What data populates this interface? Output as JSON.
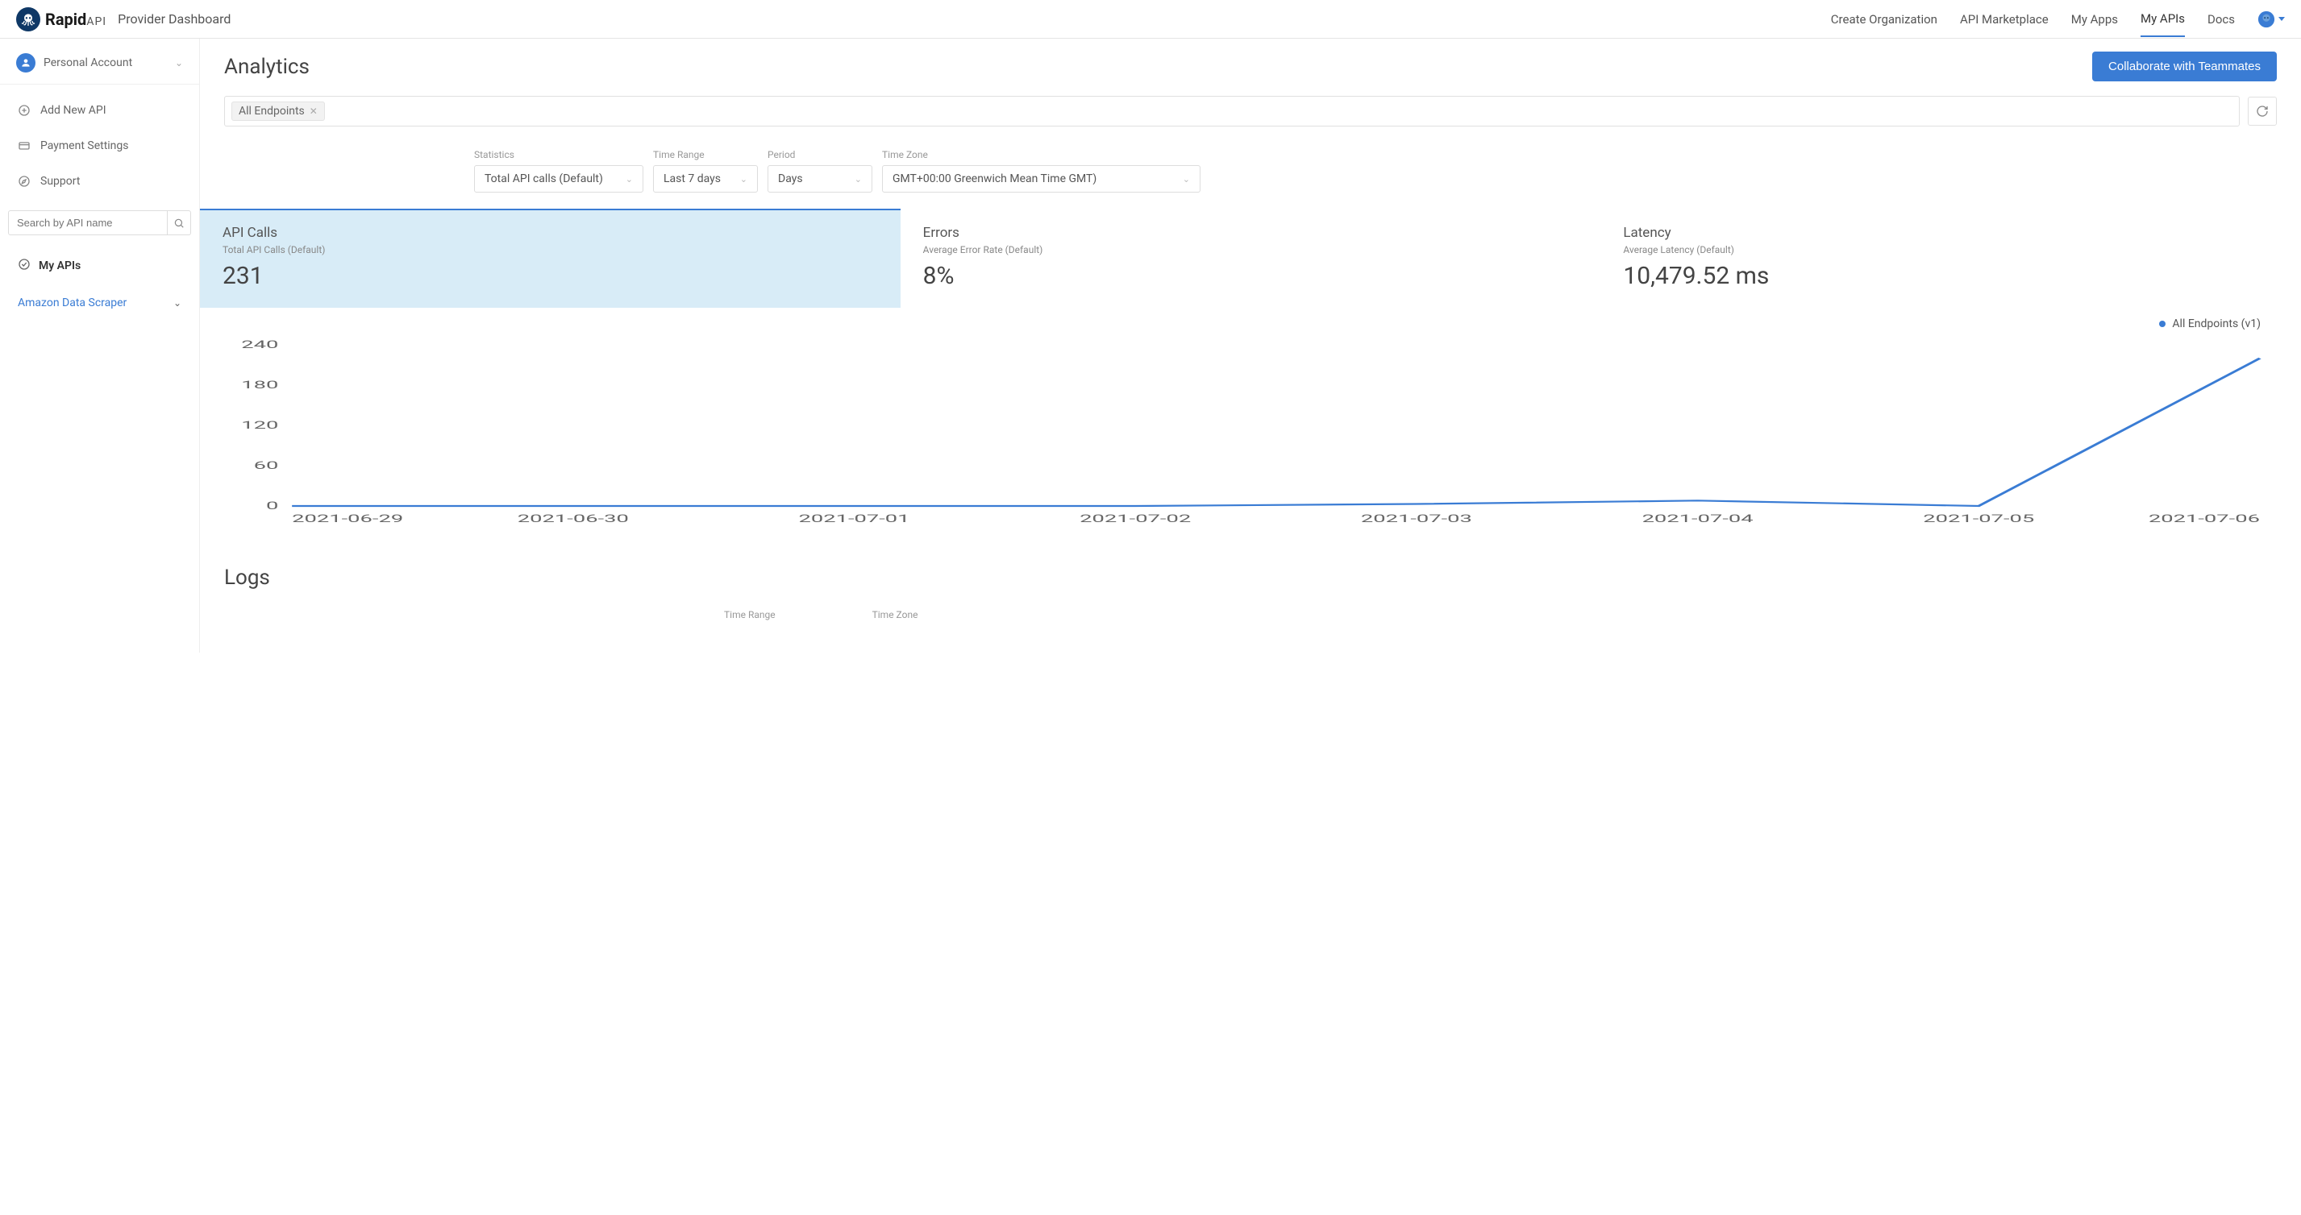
{
  "header": {
    "brand_main": "Rapid",
    "brand_sub": "API",
    "title": "Provider Dashboard",
    "nav": [
      "Create Organization",
      "API Marketplace",
      "My Apps",
      "My APIs",
      "Docs"
    ]
  },
  "sidebar": {
    "account_label": "Personal Account",
    "items": [
      {
        "label": "Add New API"
      },
      {
        "label": "Payment Settings"
      },
      {
        "label": "Support"
      }
    ],
    "search_placeholder": "Search by API name",
    "my_apis_label": "My APIs",
    "api_list": [
      {
        "label": "Amazon Data Scraper"
      }
    ]
  },
  "page": {
    "title": "Analytics",
    "collab_btn": "Collaborate with Teammates",
    "filter_chip": "All Endpoints",
    "controls": {
      "statistics_label": "Statistics",
      "statistics_value": "Total API calls (Default)",
      "timerange_label": "Time Range",
      "timerange_value": "Last 7 days",
      "period_label": "Period",
      "period_value": "Days",
      "timezone_label": "Time Zone",
      "timezone_value": "GMT+00:00 Greenwich Mean Time GMT)"
    },
    "cards": {
      "api_calls": {
        "title": "API Calls",
        "sub": "Total API Calls (Default)",
        "value": "231"
      },
      "errors": {
        "title": "Errors",
        "sub": "Average Error Rate (Default)",
        "value": "8%"
      },
      "latency": {
        "title": "Latency",
        "sub": "Average Latency (Default)",
        "value": "10,479.52 ms"
      }
    },
    "legend": "All Endpoints (v1)",
    "logs_title": "Logs",
    "logs_controls": {
      "timerange_label": "Time Range",
      "timezone_label": "Time Zone"
    }
  },
  "chart_data": {
    "type": "line",
    "title": "",
    "xlabel": "",
    "ylabel": "",
    "ylim": [
      0,
      240
    ],
    "y_ticks": [
      0,
      60,
      120,
      180,
      240
    ],
    "categories": [
      "2021-06-29",
      "2021-06-30",
      "2021-07-01",
      "2021-07-02",
      "2021-07-03",
      "2021-07-04",
      "2021-07-05",
      "2021-07-06"
    ],
    "series": [
      {
        "name": "All Endpoints (v1)",
        "values": [
          0,
          0,
          0,
          0,
          3,
          8,
          0,
          220
        ]
      }
    ]
  }
}
